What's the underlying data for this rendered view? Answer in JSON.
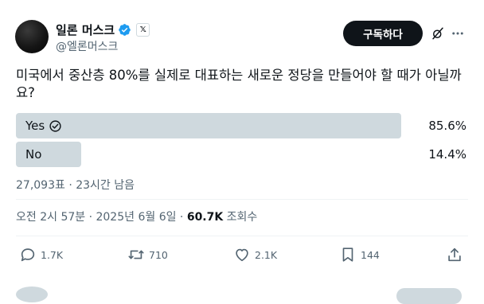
{
  "author": {
    "display_name": "일론 머스크",
    "handle": "@엘론머스크",
    "verified": true,
    "affiliate_badge": "𝕏"
  },
  "header": {
    "subscribe_label": "구독하다",
    "grok_icon": "grok-icon",
    "more_icon": "more-icon"
  },
  "post": {
    "text": "미국에서 중산층 80%를 실제로 대표하는 새로운 정당을 만들어야 할 때가 아닐까요?"
  },
  "poll": {
    "options": [
      {
        "label": "Yes",
        "percent_text": "85.6%",
        "fraction": 0.856,
        "selected": true
      },
      {
        "label": "No",
        "percent_text": "14.4%",
        "fraction": 0.144,
        "selected": false
      }
    ],
    "meta": "27,093표 · 23시간 남음"
  },
  "timestamp": {
    "prefix": "오전 2시 57분 · 2025년 6월 6일 · ",
    "views_count": "60.7K",
    "views_label": " 조회수"
  },
  "actions": {
    "replies": "1.7K",
    "reposts": "710",
    "likes": "2.1K",
    "bookmarks": "144"
  },
  "colors": {
    "bar_fill": "#cfd9de",
    "verified_blue": "#1d9bf0",
    "secondary_text": "#536471"
  }
}
